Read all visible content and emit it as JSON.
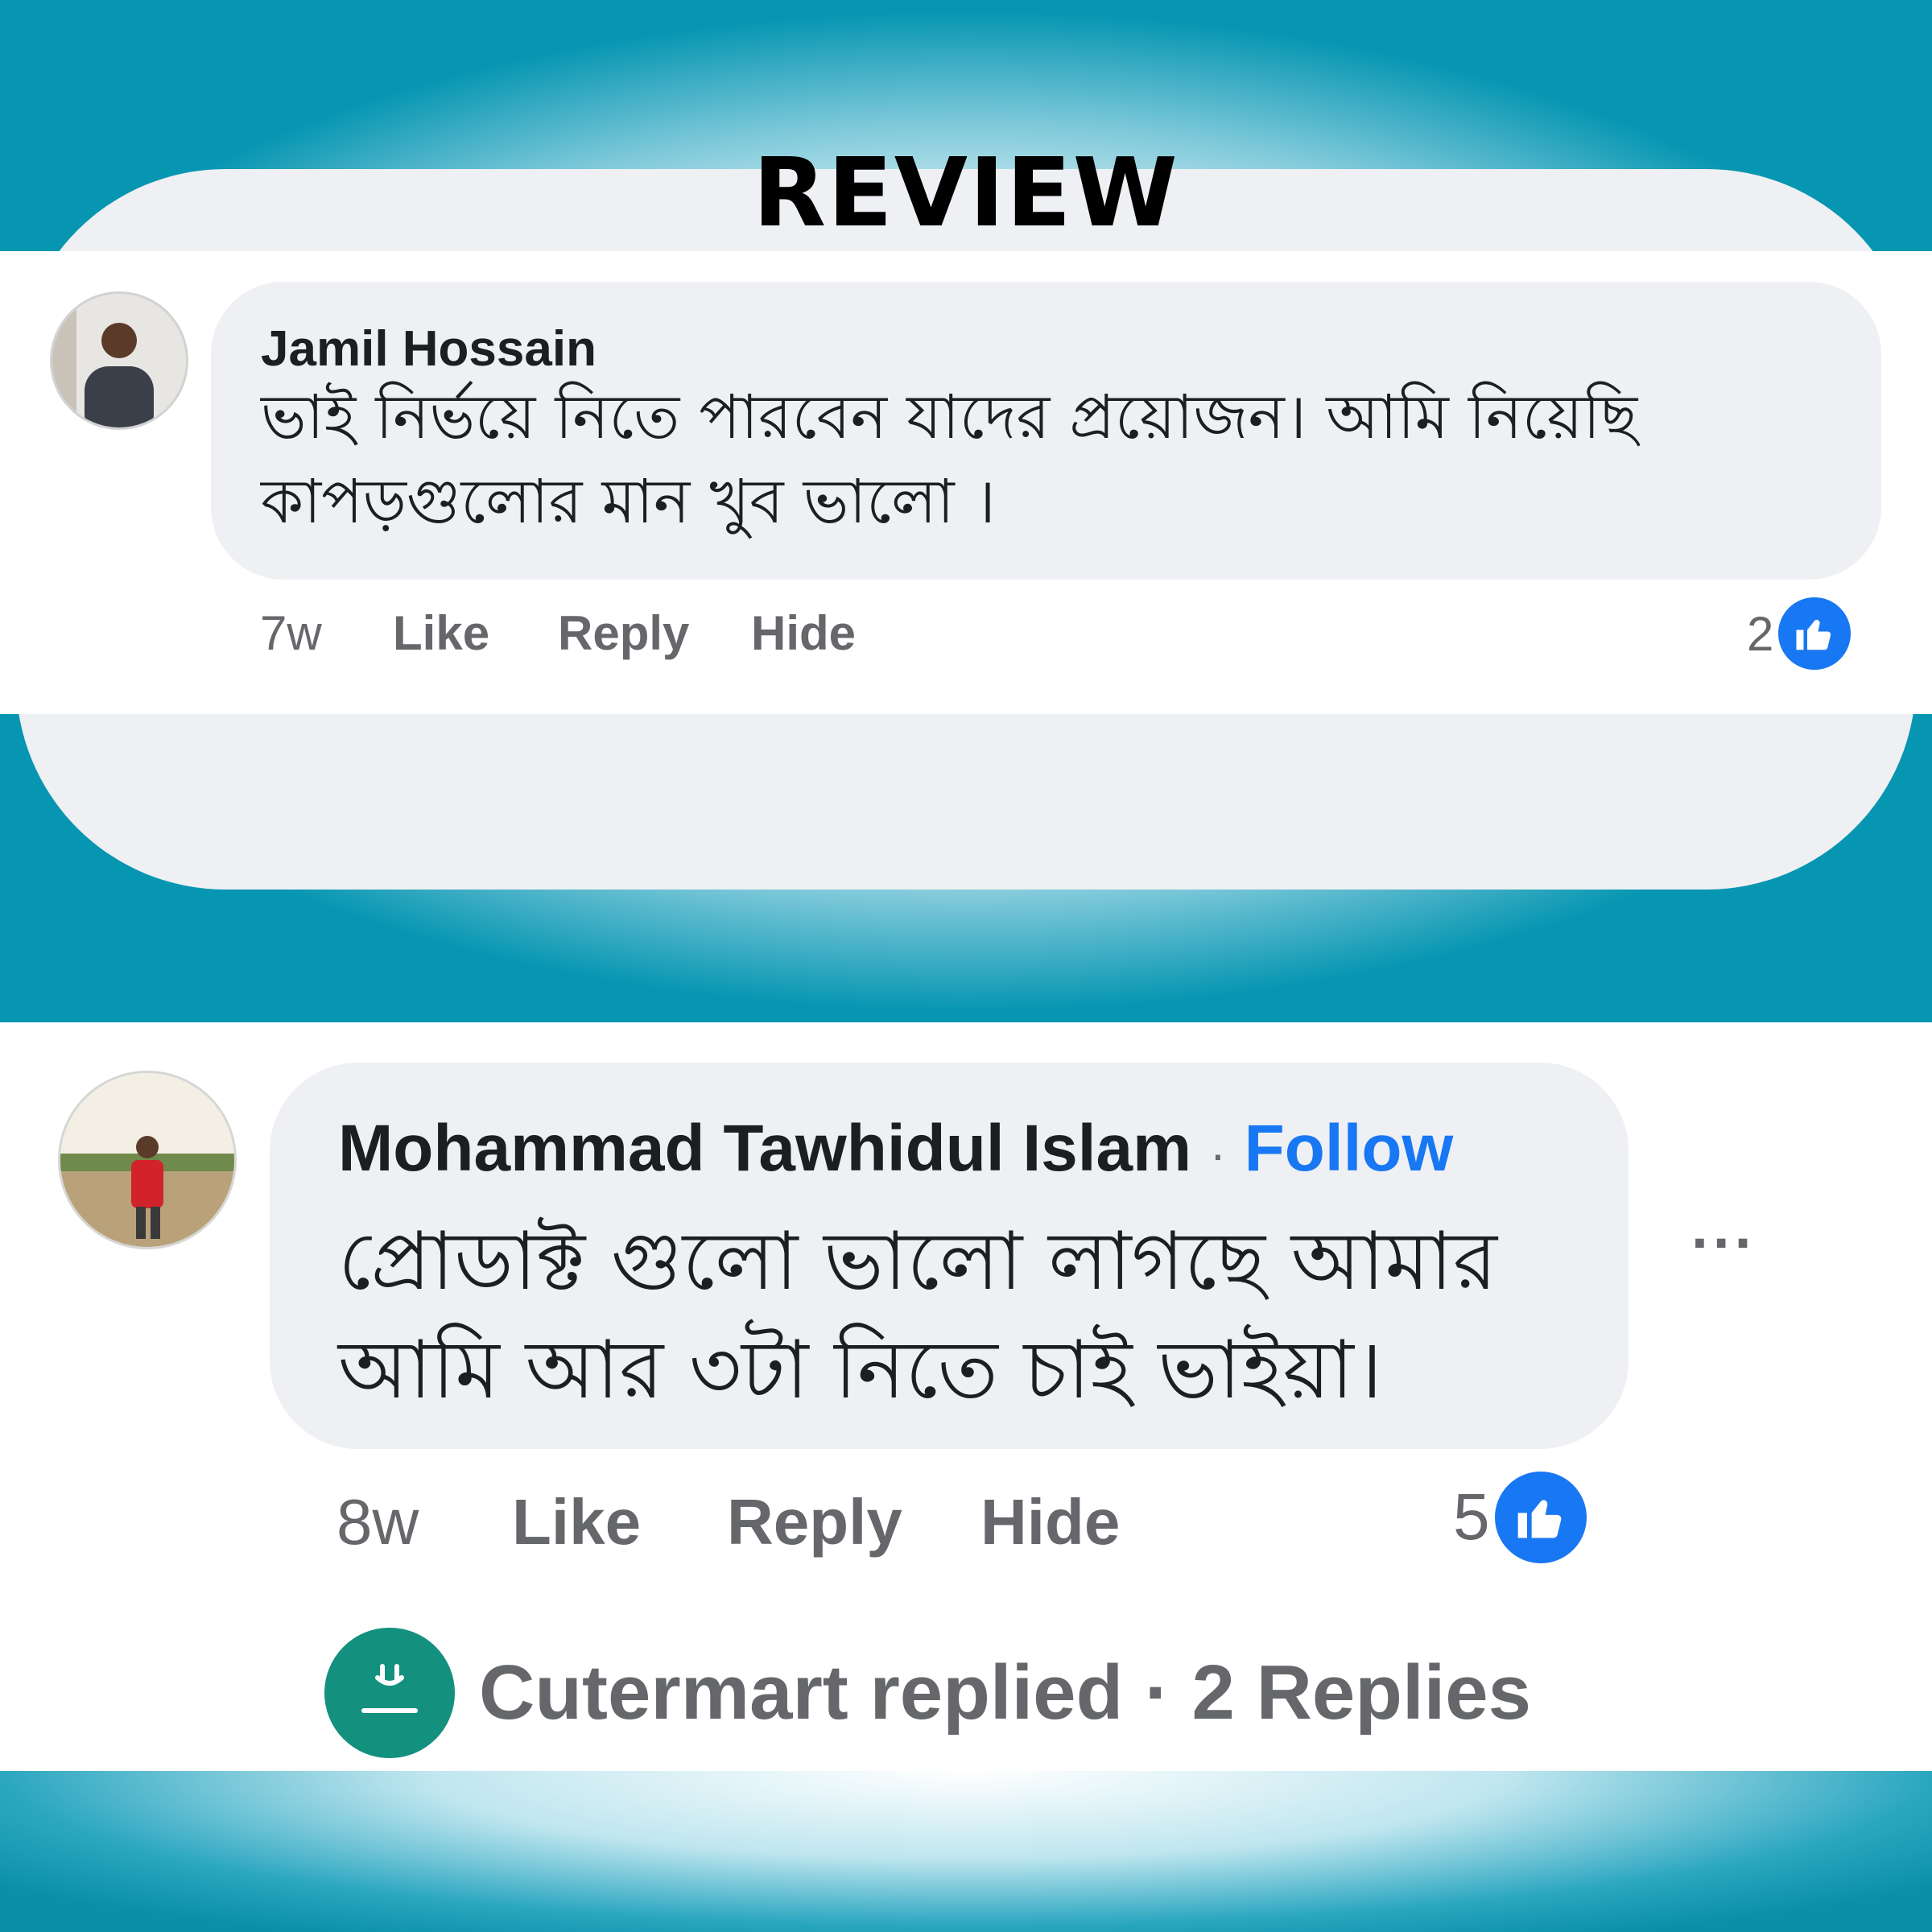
{
  "header": {
    "title": "REVIEW"
  },
  "comments": [
    {
      "author": "Jamil Hossain",
      "line1": "ভাই নির্ভয়ে নিতে পারবেন যাদের প্রয়োজন। আমি নিয়েছি",
      "line2": "কাপড়গুলোর মান খুব ভালো ।",
      "time": "7w",
      "like_label": "Like",
      "reply_label": "Reply",
      "hide_label": "Hide",
      "reaction_count": "2"
    },
    {
      "author": "Mohammad Tawhidul Islam",
      "separator": "·",
      "follow_label": "Follow",
      "line1": "প্রোডাক্ট গুলো ভালো লাগছে আমার",
      "line2": "আমি আর ৩টা নিতে চাই ভাইয়া।",
      "time": "8w",
      "like_label": "Like",
      "reply_label": "Reply",
      "hide_label": "Hide",
      "reaction_count": "5",
      "more_label": "···",
      "replies_summary": "Cutermart replied · 2 Replies"
    }
  ],
  "colors": {
    "accent": "#1877f2",
    "teal": "#0a93ad",
    "bubble": "#eef0f3"
  },
  "icons": [
    "like-thumb-icon",
    "more-options-icon",
    "avatar-photo",
    "page-logo-icon"
  ]
}
